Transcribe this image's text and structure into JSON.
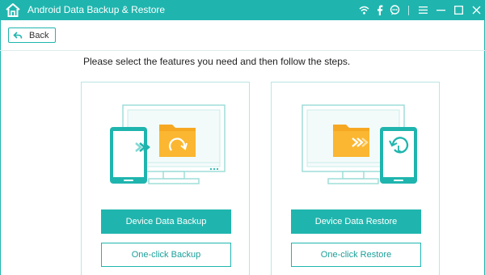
{
  "titlebar": {
    "title": "Android Data Backup & Restore",
    "icons": [
      "wifi-icon",
      "facebook-icon",
      "chat-icon",
      "menu-icon",
      "minimize-icon",
      "maximize-icon",
      "close-icon"
    ],
    "accent": "#1fb5ae"
  },
  "nav": {
    "back_label": "Back"
  },
  "main": {
    "instruction": "Please select the features you need and then follow the steps."
  },
  "panels": [
    {
      "primary_label": "Device Data Backup",
      "secondary_label": "One-click Backup"
    },
    {
      "primary_label": "Device Data Restore",
      "secondary_label": "One-click Restore"
    }
  ],
  "colors": {
    "accent": "#1fb5ae",
    "folder": "#f7a823",
    "panel_border": "#b9e6e3"
  }
}
